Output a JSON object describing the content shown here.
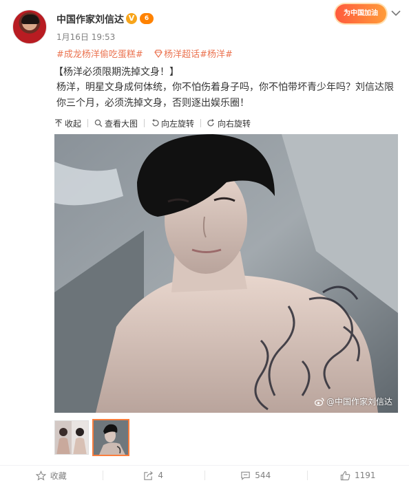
{
  "post": {
    "author": "中国作家刘信达",
    "verified_badge": "V",
    "level_badge": "6",
    "timestamp": "1月16日 19:53",
    "campaign_label": "为中国加油",
    "tags": [
      "#成龙杨洋偷吃蛋糕#",
      "杨洋超话",
      "#杨洋#"
    ],
    "title": "【杨洋必须限期洗掉文身！】",
    "body": "杨洋，明星文身成何体统，你不怕伤着身子吗，你不怕带坏青少年吗？刘信达限你三个月，必须洗掉文身，否则逐出娱乐圈！"
  },
  "media_tools": {
    "collapse": "收起",
    "view_large": "查看大图",
    "rotate_left": "向左旋转",
    "rotate_right": "向右旋转"
  },
  "image": {
    "watermark": "@中国作家刘信达"
  },
  "footer": {
    "favorite_label": "收藏",
    "repost_count": "4",
    "comment_count": "544",
    "like_count": "1191"
  },
  "colors": {
    "accent": "#eb7350",
    "thumb_selected": "#fa7d3c",
    "verified": "#f7a51c"
  }
}
